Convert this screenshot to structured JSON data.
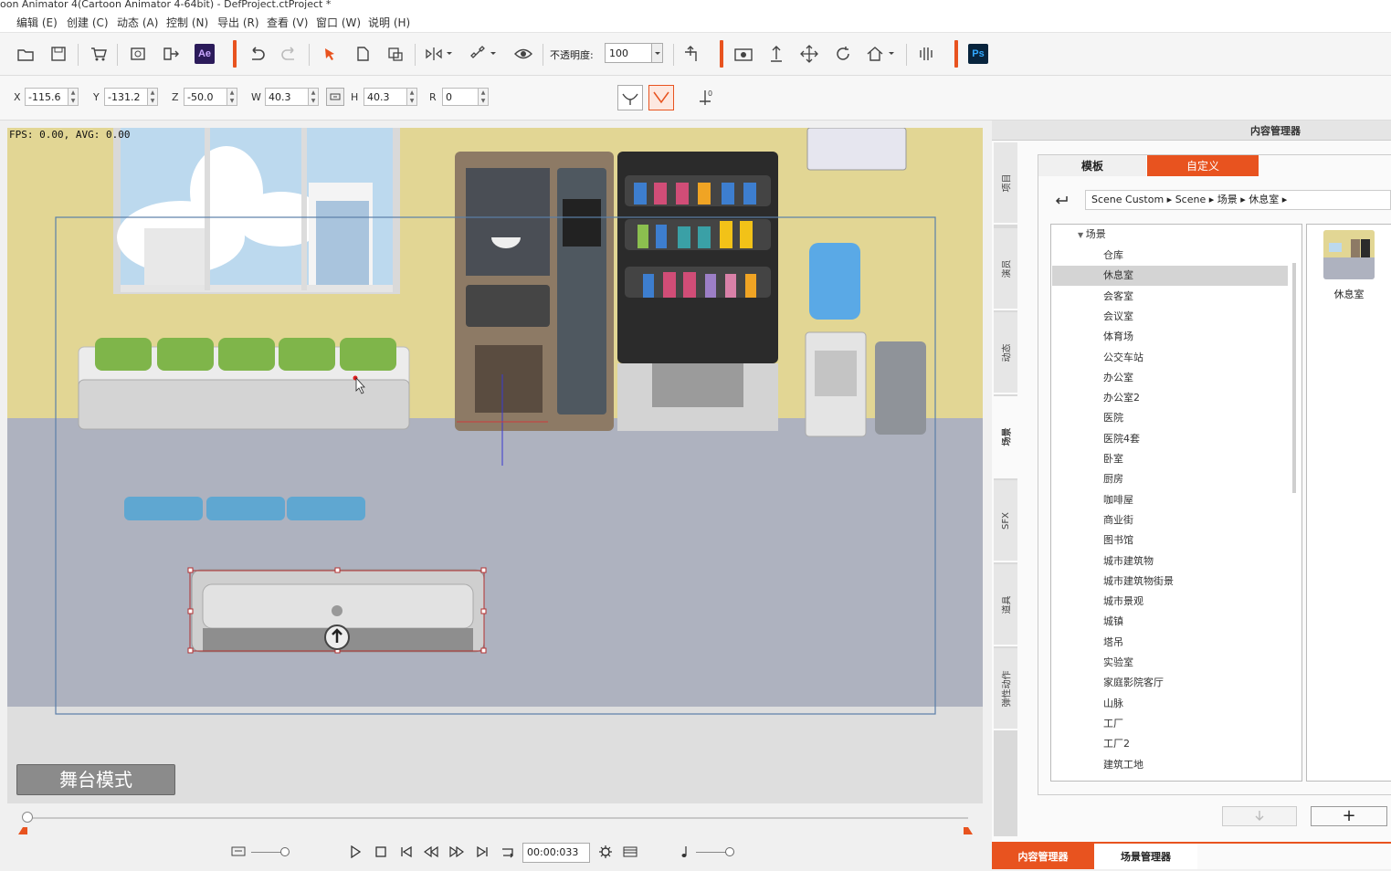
{
  "window": {
    "title": "oon Animator 4(Cartoon Animator 4-64bit) - DefProject.ctProject *"
  },
  "menu": [
    {
      "label": "编辑 (E)"
    },
    {
      "label": "创建 (C)"
    },
    {
      "label": "动态 (A)"
    },
    {
      "label": "控制 (N)"
    },
    {
      "label": "导出 (R)"
    },
    {
      "label": "查看 (V)"
    },
    {
      "label": "窗口 (W)"
    },
    {
      "label": "说明 (H)"
    }
  ],
  "toolbar": {
    "ae_label": "Ae",
    "ps_label": "Ps",
    "opacity_label": "不透明度:",
    "opacity_value": "100"
  },
  "props": {
    "x_label": "X",
    "x_value": "-115.6",
    "y_label": "Y",
    "y_value": "-131.2",
    "z_label": "Z",
    "z_value": "-50.0",
    "w_label": "W",
    "w_value": "40.3",
    "h_label": "H",
    "h_value": "40.3",
    "r_label": "R",
    "r_value": "0"
  },
  "stage": {
    "fps_text": "FPS: 0.00, AVG: 0.00",
    "mode_button": "舞台模式"
  },
  "timeline": {
    "timecode": "00:00:033"
  },
  "panel": {
    "title": "内容管理器",
    "tab_template": "模板",
    "tab_custom": "自定义",
    "breadcrumb": [
      "Scene Custom",
      "Scene",
      "场景",
      "休息室"
    ],
    "tree_root": "场景",
    "tree_items": [
      "仓库",
      "休息室",
      "会客室",
      "会议室",
      "体育场",
      "公交车站",
      "办公室",
      "办公室2",
      "医院",
      "医院4套",
      "卧室",
      "厨房",
      "咖啡屋",
      "商业街",
      "图书馆",
      "城市建筑物",
      "城市建筑物街景",
      "城市景观",
      "城镇",
      "塔吊",
      "实验室",
      "家庭影院客厅",
      "山脉",
      "工厂",
      "工厂2",
      "建筑工地"
    ],
    "selected_item": "休息室",
    "thumb_label": "休息室",
    "vtabs": [
      "项目",
      "演员",
      "动态",
      "场景",
      "SFX",
      "道具",
      "弹性动作"
    ],
    "bottom_tab_content": "内容管理器",
    "bottom_tab_scene": "场景管理器",
    "add_label": "+"
  },
  "colors": {
    "accent": "#e8531f",
    "stage_wall": "#e2d694",
    "stage_floor": "#aeb2bf"
  }
}
